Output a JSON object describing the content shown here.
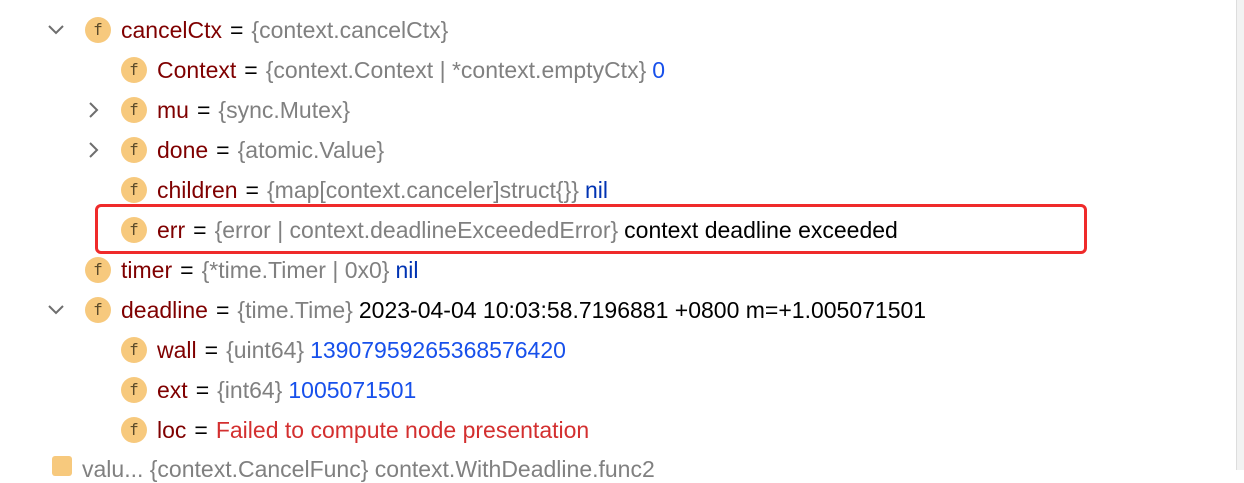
{
  "rows": [
    {
      "name": "cancelCtx",
      "type": "{context.cancelCtx}",
      "value": "",
      "value_kind": "plain",
      "expander": "expanded"
    },
    {
      "name": "Context",
      "type": "{context.Context | *context.emptyCtx}",
      "value": "0",
      "value_kind": "num",
      "expander": "none"
    },
    {
      "name": "mu",
      "type": "{sync.Mutex}",
      "value": "",
      "value_kind": "plain",
      "expander": "collapsed"
    },
    {
      "name": "done",
      "type": "{atomic.Value}",
      "value": "",
      "value_kind": "plain",
      "expander": "collapsed"
    },
    {
      "name": "children",
      "type": "{map[context.canceler]struct{}}",
      "value": "nil",
      "value_kind": "kw",
      "expander": "none"
    },
    {
      "name": "err",
      "type": "{error | context.deadlineExceededError}",
      "value": "context deadline exceeded",
      "value_kind": "plain",
      "expander": "none"
    },
    {
      "name": "timer",
      "type": "{*time.Timer | 0x0}",
      "value": "nil",
      "value_kind": "kw",
      "expander": "none"
    },
    {
      "name": "deadline",
      "type": "{time.Time}",
      "value": "2023-04-04 10:03:58.7196881 +0800 m=+1.005071501",
      "value_kind": "plain",
      "expander": "expanded"
    },
    {
      "name": "wall",
      "type": "{uint64}",
      "value": "13907959265368576420",
      "value_kind": "num",
      "expander": "none"
    },
    {
      "name": "ext",
      "type": "{int64}",
      "value": "1005071501",
      "value_kind": "num",
      "expander": "none"
    },
    {
      "name": "loc",
      "type": "",
      "value": "Failed to compute node presentation",
      "value_kind": "err",
      "expander": "none"
    }
  ],
  "field_icon_letter": "f",
  "equals_sign": "=",
  "cut_off_row_text": "valu... {context.CancelFunc} context.WithDeadline.func2",
  "colors": {
    "name": "#7f0000",
    "type": "#808080",
    "number": "#1750eb",
    "keyword": "#0033b3",
    "error": "#d32f2f",
    "icon": "#f7c97d",
    "highlight": "#ef2a2a"
  }
}
